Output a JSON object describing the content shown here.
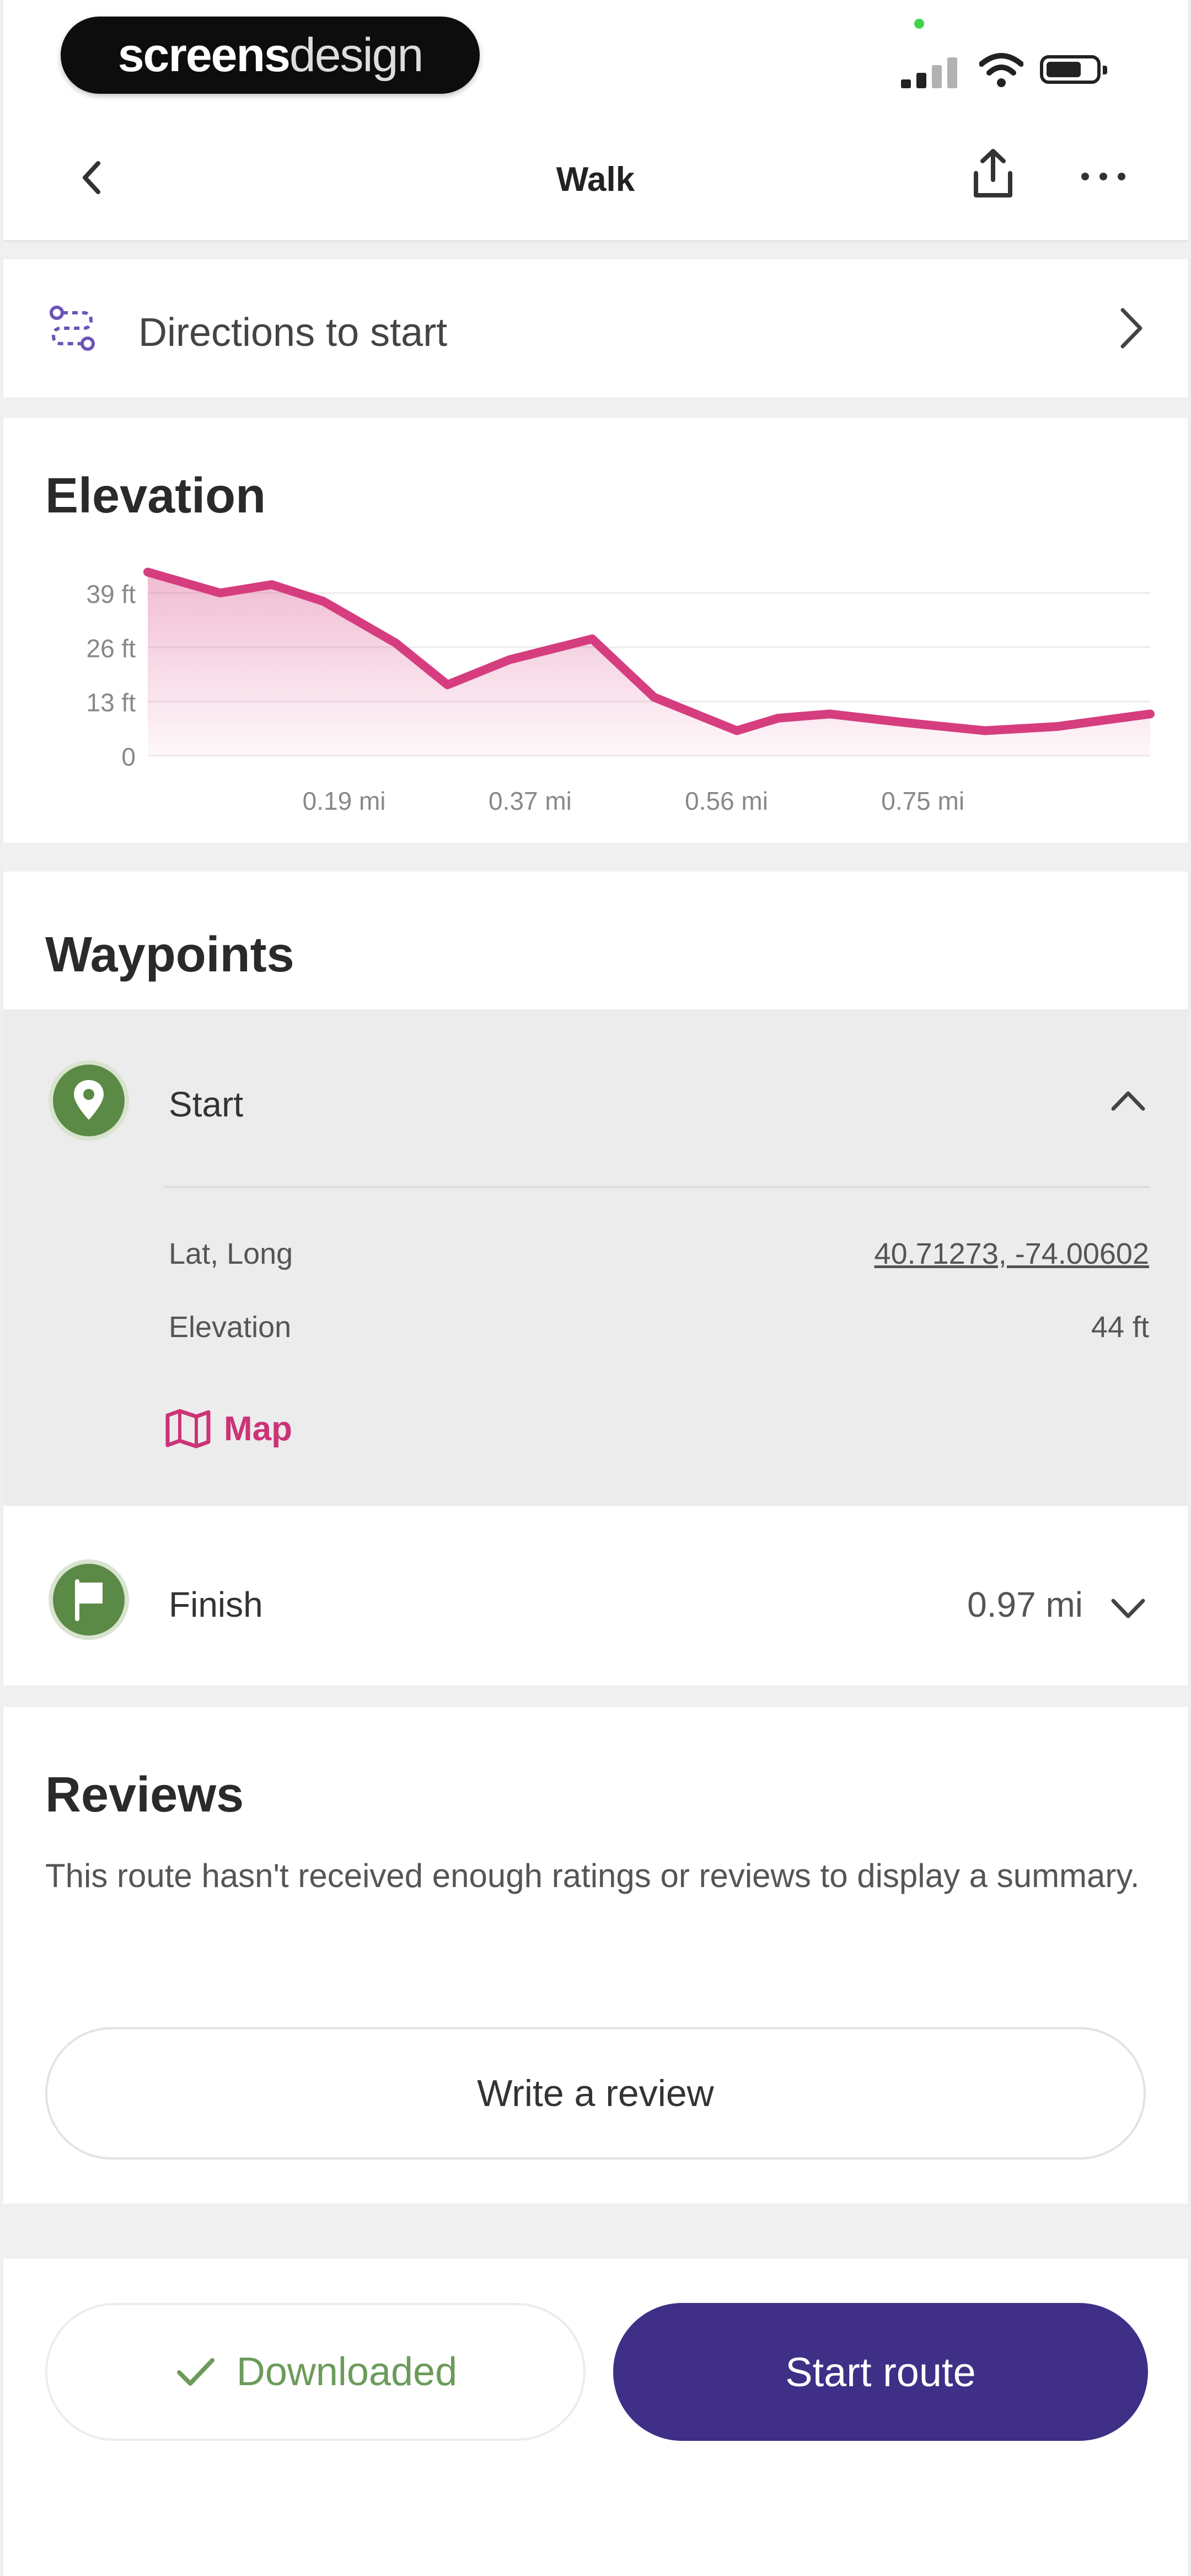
{
  "status_bar": {
    "brand_bold": "screens",
    "brand_light": "design"
  },
  "nav": {
    "title": "Walk"
  },
  "directions": {
    "label": "Directions to start"
  },
  "elevation": {
    "title": "Elevation"
  },
  "chart_data": {
    "type": "area",
    "title": "",
    "xlabel": "",
    "ylabel": "",
    "x_tick_labels": [
      "0.19 mi",
      "0.37 mi",
      "0.56 mi",
      "0.75 mi"
    ],
    "y_tick_labels": [
      "39 ft",
      "26 ft",
      "13 ft",
      "0"
    ],
    "x_unit": "mi",
    "y_unit": "ft",
    "xlim": [
      0,
      0.97
    ],
    "ylim": [
      0,
      39
    ],
    "grid": true,
    "series": [
      {
        "color": "#d63d7f",
        "points": [
          [
            0.0,
            44
          ],
          [
            0.07,
            39
          ],
          [
            0.12,
            41
          ],
          [
            0.17,
            37
          ],
          [
            0.24,
            27
          ],
          [
            0.29,
            17
          ],
          [
            0.35,
            23
          ],
          [
            0.43,
            28
          ],
          [
            0.49,
            14
          ],
          [
            0.57,
            6
          ],
          [
            0.61,
            9
          ],
          [
            0.66,
            10
          ],
          [
            0.73,
            8
          ],
          [
            0.81,
            6
          ],
          [
            0.88,
            7
          ],
          [
            0.97,
            10
          ]
        ]
      }
    ]
  },
  "waypoints": {
    "title": "Waypoints",
    "start": {
      "name": "Start",
      "lat_long_label": "Lat, Long",
      "lat_long_value": "40.71273, -74.00602",
      "elevation_label": "Elevation",
      "elevation_value": "44 ft",
      "map_label": "Map"
    },
    "finish": {
      "name": "Finish",
      "distance": "0.97 mi"
    }
  },
  "reviews": {
    "title": "Reviews",
    "message": "This route hasn't received enough ratings or reviews to display a summary.",
    "write_button": "Write a review"
  },
  "bottom": {
    "downloaded_label": "Downloaded",
    "start_label": "Start route"
  },
  "colors": {
    "accent_purple": "#3f2f86",
    "chart_pink": "#d63d7f",
    "badge_green": "#5a8a45",
    "success_green": "#6c9b5b",
    "link_pink": "#cc3377"
  }
}
